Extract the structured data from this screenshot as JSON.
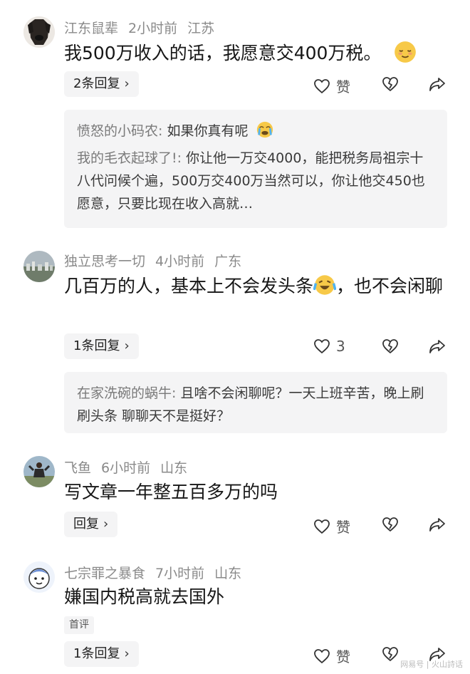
{
  "comments": [
    {
      "user": "江东鼠辈",
      "time": "2小时前",
      "location": "江苏",
      "text": "我500万收入的话，我愿意交400万税。",
      "reply_label": "2条回复",
      "like_label": "赞",
      "replies": [
        {
          "author": "愤怒的小码农",
          "text": "如果你真有呢"
        },
        {
          "author": "我的毛衣起球了!",
          "text": "你让他一万交4000，能把税务局祖宗十八代问候个遍，500万交400万当然可以，你让他交450也愿意，只要比现在收入高就…"
        }
      ]
    },
    {
      "user": "独立思考一切",
      "time": "4小时前",
      "location": "广东",
      "text": "几百万的人，基本上不会发头条",
      "text_tail": "，也不会闲聊",
      "reply_label": "1条回复",
      "like_count": "3",
      "replies": [
        {
          "author": "在家洗碗的蜗牛",
          "text": "且啥不会闲聊呢？一天上班辛苦，晚上刷刷头条 聊聊天不是挺好？"
        }
      ]
    },
    {
      "user": "飞鱼",
      "time": "6小时前",
      "location": "山东",
      "text": "写文章一年整五百多万的吗",
      "reply_label": "回复",
      "like_label": "赞"
    },
    {
      "user": "七宗罪之暴食",
      "time": "7小时前",
      "location": "山东",
      "text": "嫌国内税高就去国外",
      "badge": "首评",
      "reply_label": "1条回复",
      "like_label": "赞"
    }
  ],
  "chevron": "›",
  "colon": ":",
  "watermark": "网易号 | 火山詩话"
}
